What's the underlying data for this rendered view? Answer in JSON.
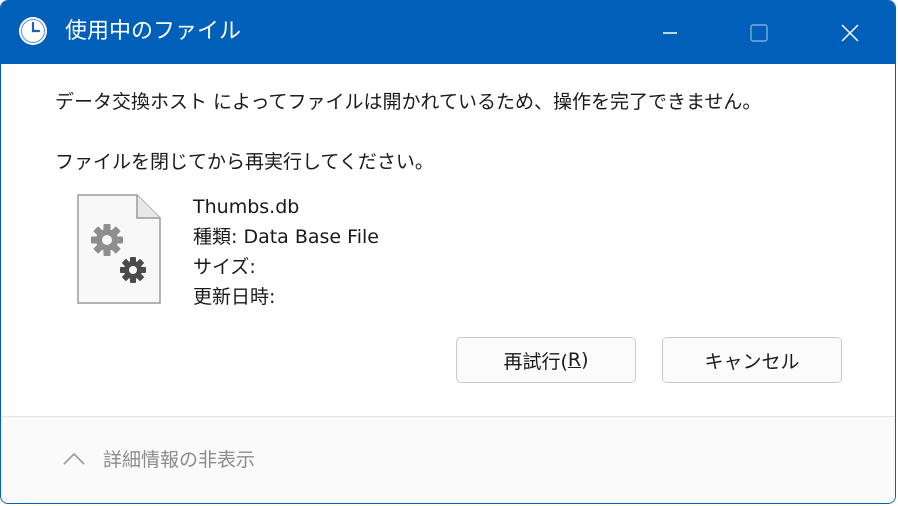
{
  "titlebar": {
    "title": "使用中のファイル",
    "icon": "clock-icon",
    "controls": [
      "minimize-icon",
      "maximize-icon",
      "close-icon"
    ],
    "accent_color": "#005fb8"
  },
  "message": {
    "line1": "データ交換ホスト によってファイルは開かれているため、操作を完了できません。",
    "line2": "ファイルを閉じてから再実行してください。"
  },
  "file": {
    "icon": "settings-file-icon",
    "name": "Thumbs.db",
    "type_label": "種類: Data Base File",
    "size_label": "サイズ:",
    "modified_label": "更新日時:"
  },
  "buttons": {
    "retry_prefix": "再試行(",
    "retry_accel": "R",
    "retry_suffix": ")",
    "cancel": "キャンセル"
  },
  "footer": {
    "details_label": "詳細情報の非表示",
    "details_icon": "chevron-up-icon"
  }
}
